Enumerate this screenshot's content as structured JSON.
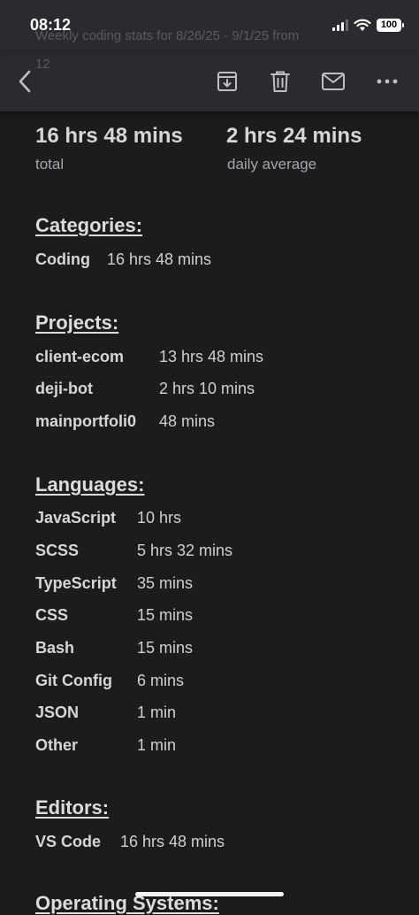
{
  "status_bar": {
    "time": "08:12",
    "battery": "100"
  },
  "background_text": {
    "line1": "Weekly coding stats for 8/26/25 - 9/1/25 from",
    "line2": "12"
  },
  "toolbar": {
    "back": "back",
    "archive": "archive",
    "delete": "delete",
    "mail": "mark unread",
    "more": "more"
  },
  "summary": {
    "total_value": "16 hrs 48 mins",
    "total_label": "total",
    "average_value": "2 hrs 24 mins",
    "average_label": "daily average"
  },
  "categories": {
    "heading": "Categories:",
    "items": [
      {
        "name": "Coding",
        "time": "16 hrs 48 mins"
      }
    ]
  },
  "projects": {
    "heading": "Projects:",
    "items": [
      {
        "name": "client-ecom",
        "time": "13 hrs 48 mins"
      },
      {
        "name": "deji-bot",
        "time": "2 hrs 10 mins"
      },
      {
        "name": "mainportfoli0",
        "time": "48 mins"
      }
    ]
  },
  "languages": {
    "heading": "Languages:",
    "items": [
      {
        "name": "JavaScript",
        "time": "10 hrs"
      },
      {
        "name": "SCSS",
        "time": "5 hrs 32 mins"
      },
      {
        "name": "TypeScript",
        "time": "35 mins"
      },
      {
        "name": "CSS",
        "time": "15 mins"
      },
      {
        "name": "Bash",
        "time": "15 mins"
      },
      {
        "name": "Git Config",
        "time": "6 mins"
      },
      {
        "name": "JSON",
        "time": "1 min"
      },
      {
        "name": "Other",
        "time": "1 min"
      }
    ]
  },
  "editors": {
    "heading": "Editors:",
    "items": [
      {
        "name": "VS Code",
        "time": "16 hrs 48 mins"
      }
    ]
  },
  "operating_systems": {
    "heading": "Operating Systems:"
  }
}
